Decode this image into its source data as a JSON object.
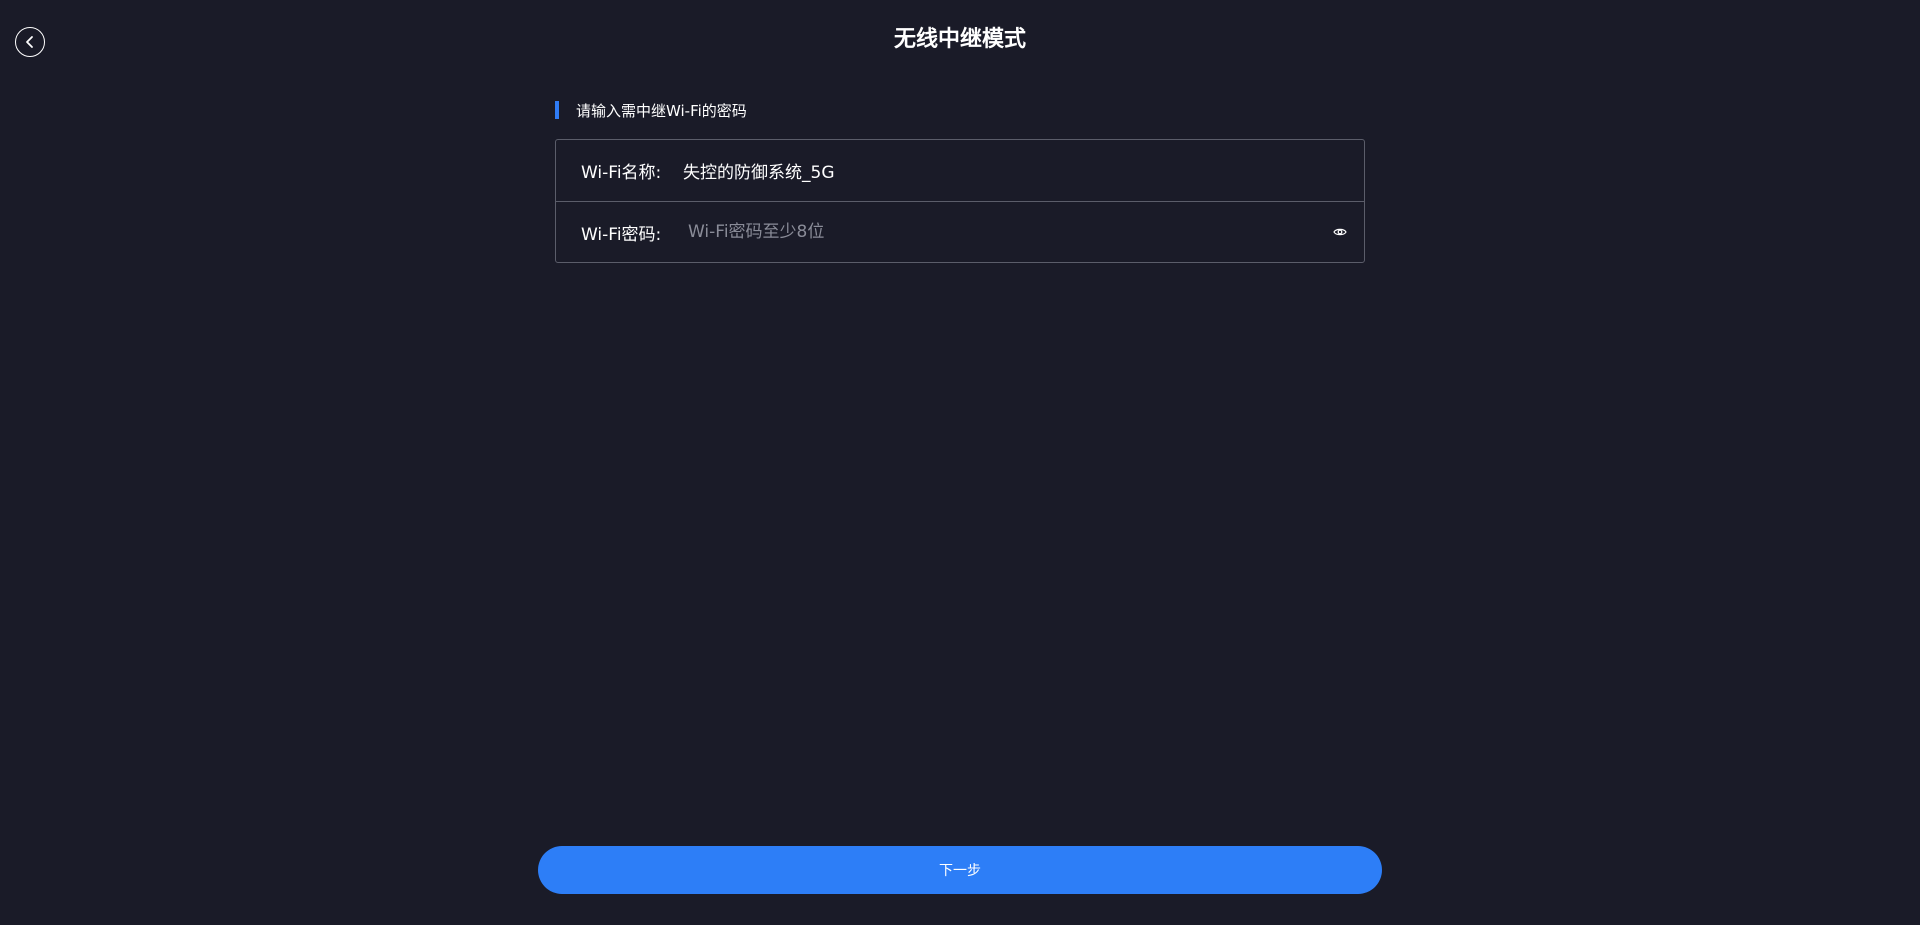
{
  "header": {
    "title": "无线中继模式",
    "back_icon": "chevron-left-circle-icon"
  },
  "section": {
    "label": "请输入需中继Wi-Fi的密码",
    "accent_color": "#2f7cf6"
  },
  "form": {
    "wifi_name_label": "Wi-Fi名称:",
    "wifi_name_value": "失控的防御系统_5G",
    "wifi_password_label": "Wi-Fi密码:",
    "wifi_password_value": "",
    "wifi_password_placeholder": "Wi-Fi密码至少8位",
    "visibility_icon": "eye-icon"
  },
  "footer": {
    "next_label": "下一步",
    "button_color": "#2d7ef7"
  }
}
